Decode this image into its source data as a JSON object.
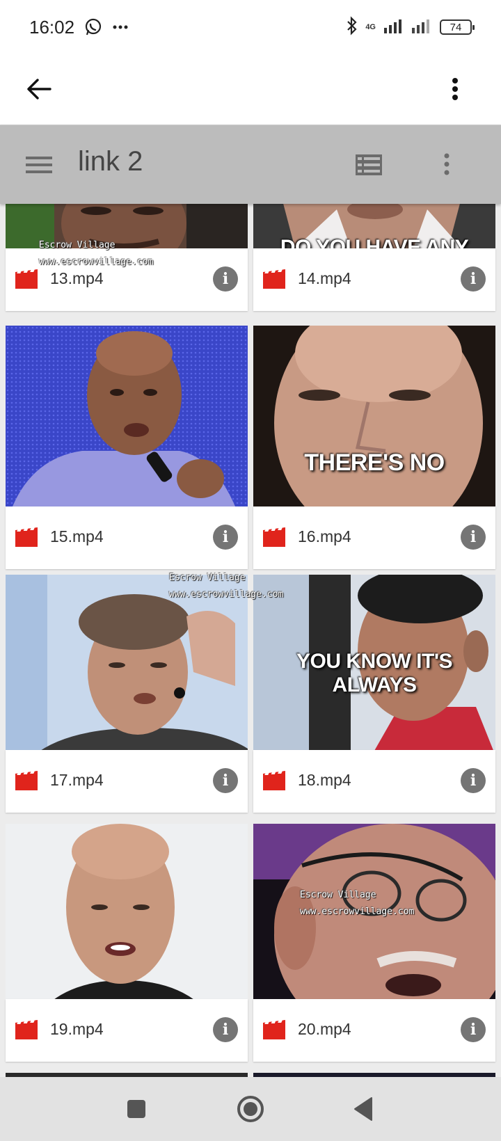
{
  "status_bar": {
    "time": "16:02",
    "network": "4G",
    "battery": "74",
    "icons": [
      "whatsapp-icon",
      "more-dots-icon",
      "bluetooth-icon",
      "signal-icon",
      "signal-icon-2",
      "battery-icon"
    ]
  },
  "app_bar": {
    "back_icon": "arrow-back-icon",
    "menu_icon": "more-vert-icon"
  },
  "toolbar": {
    "title": "link 2",
    "menu_icon": "hamburger-icon",
    "view_icon": "list-view-icon",
    "overflow_icon": "more-vert-icon"
  },
  "files": [
    {
      "name": "13.mp4",
      "caption": ""
    },
    {
      "name": "14.mp4",
      "caption": "DO YOU HAVE ANY REGRETS?"
    },
    {
      "name": "15.mp4",
      "caption": ""
    },
    {
      "name": "16.mp4",
      "caption": "THERE'S NO"
    },
    {
      "name": "17.mp4",
      "caption": ""
    },
    {
      "name": "18.mp4",
      "caption": "YOU KNOW IT'S ALWAYS"
    },
    {
      "name": "19.mp4",
      "caption": ""
    },
    {
      "name": "20.mp4",
      "caption": ""
    }
  ],
  "watermark": {
    "line1": "Escrow Village",
    "line2": "www.escrowvillage.com"
  },
  "nav_bar": {
    "icons": [
      "recents-square-icon",
      "home-circle-icon",
      "back-triangle-icon"
    ]
  },
  "colors": {
    "file_icon": "#e0241c",
    "toolbar_bg": "#bcbcbc",
    "info_btn": "#757575"
  }
}
